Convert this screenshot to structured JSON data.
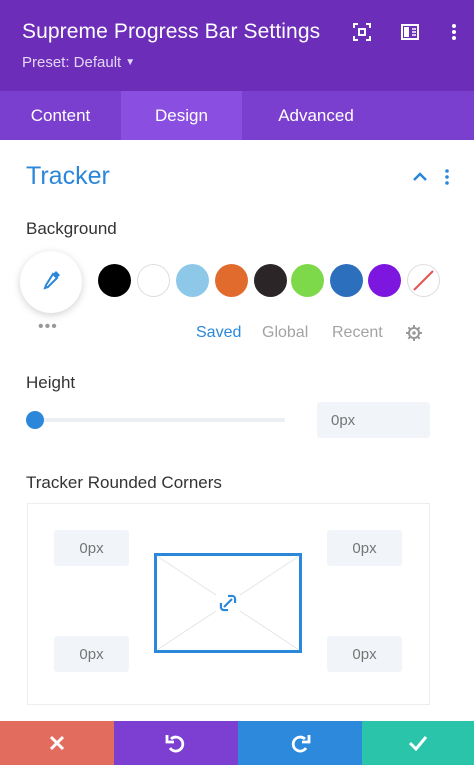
{
  "header": {
    "title": "Supreme Progress Bar Settings",
    "preset_label": "Preset: Default",
    "bg_color": "#6c2eb9"
  },
  "tabs": [
    {
      "label": "Content",
      "active": false
    },
    {
      "label": "Design",
      "active": true
    },
    {
      "label": "Advanced",
      "active": false
    }
  ],
  "section": {
    "title": "Tracker",
    "expanded": true
  },
  "background": {
    "label": "Background",
    "swatches": [
      "#000000",
      "#ffffff",
      "#8ec8e8",
      "#e06b2c",
      "#2b2528",
      "#7ed94a",
      "#2b6fbd",
      "#7d16df",
      "none"
    ],
    "palette_tabs": [
      {
        "label": "Saved",
        "active": true
      },
      {
        "label": "Global",
        "active": false
      },
      {
        "label": "Recent",
        "active": false
      }
    ]
  },
  "height": {
    "label": "Height",
    "slider_value": 0,
    "placeholder": "0px"
  },
  "corners": {
    "label": "Tracker Rounded Corners",
    "top_left_placeholder": "0px",
    "top_right_placeholder": "0px",
    "bottom_left_placeholder": "0px",
    "bottom_right_placeholder": "0px",
    "linked": true
  },
  "footer": {
    "cancel_color": "#e26c5d",
    "undo_color": "#7c3fd1",
    "redo_color": "#2d89dc",
    "save_color": "#29c4a9"
  }
}
